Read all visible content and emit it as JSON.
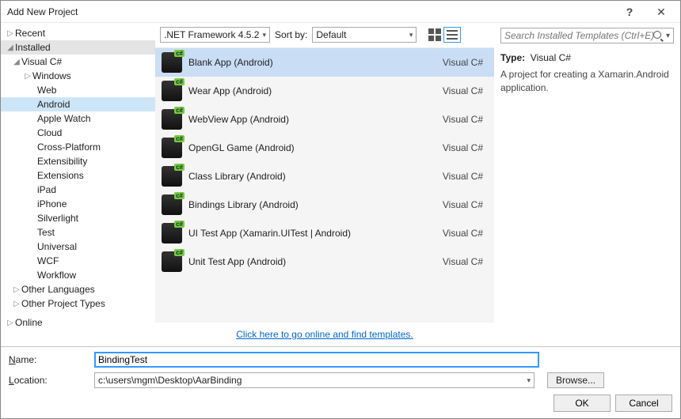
{
  "window": {
    "title": "Add New Project"
  },
  "tree": {
    "recent": "Recent",
    "installed": "Installed",
    "visualcs": "Visual C#",
    "nodes": [
      "Windows",
      "Web",
      "Android",
      "Apple Watch",
      "Cloud",
      "Cross-Platform",
      "Extensibility",
      "Extensions",
      "iPad",
      "iPhone",
      "Silverlight",
      "Test",
      "Universal",
      "WCF",
      "Workflow"
    ],
    "selected": "Android",
    "other_langs": "Other Languages",
    "other_types": "Other Project Types",
    "online": "Online"
  },
  "filter": {
    "framework": ".NET Framework 4.5.2",
    "sortlabel": "Sort by:",
    "sortby": "Default"
  },
  "templates": [
    {
      "label": "Blank App (Android)",
      "lang": "Visual C#",
      "selected": true
    },
    {
      "label": "Wear App (Android)",
      "lang": "Visual C#"
    },
    {
      "label": "WebView App (Android)",
      "lang": "Visual C#"
    },
    {
      "label": "OpenGL Game (Android)",
      "lang": "Visual C#"
    },
    {
      "label": "Class Library (Android)",
      "lang": "Visual C#"
    },
    {
      "label": "Bindings Library (Android)",
      "lang": "Visual C#"
    },
    {
      "label": "UI Test App (Xamarin.UITest | Android)",
      "lang": "Visual C#"
    },
    {
      "label": "Unit Test App (Android)",
      "lang": "Visual C#"
    }
  ],
  "online_link": "Click here to go online and find templates.",
  "search": {
    "placeholder": "Search Installed Templates (Ctrl+E)"
  },
  "details": {
    "type_label": "Type:",
    "type_value": "Visual C#",
    "description": "A project for creating a Xamarin.Android application."
  },
  "form": {
    "name_label": "Name:",
    "name_value": "BindingTest",
    "location_label": "Location:",
    "location_value": "c:\\users\\mgm\\Desktop\\AarBinding",
    "browse_label": "Browse...",
    "ok": "OK",
    "cancel": "Cancel"
  }
}
